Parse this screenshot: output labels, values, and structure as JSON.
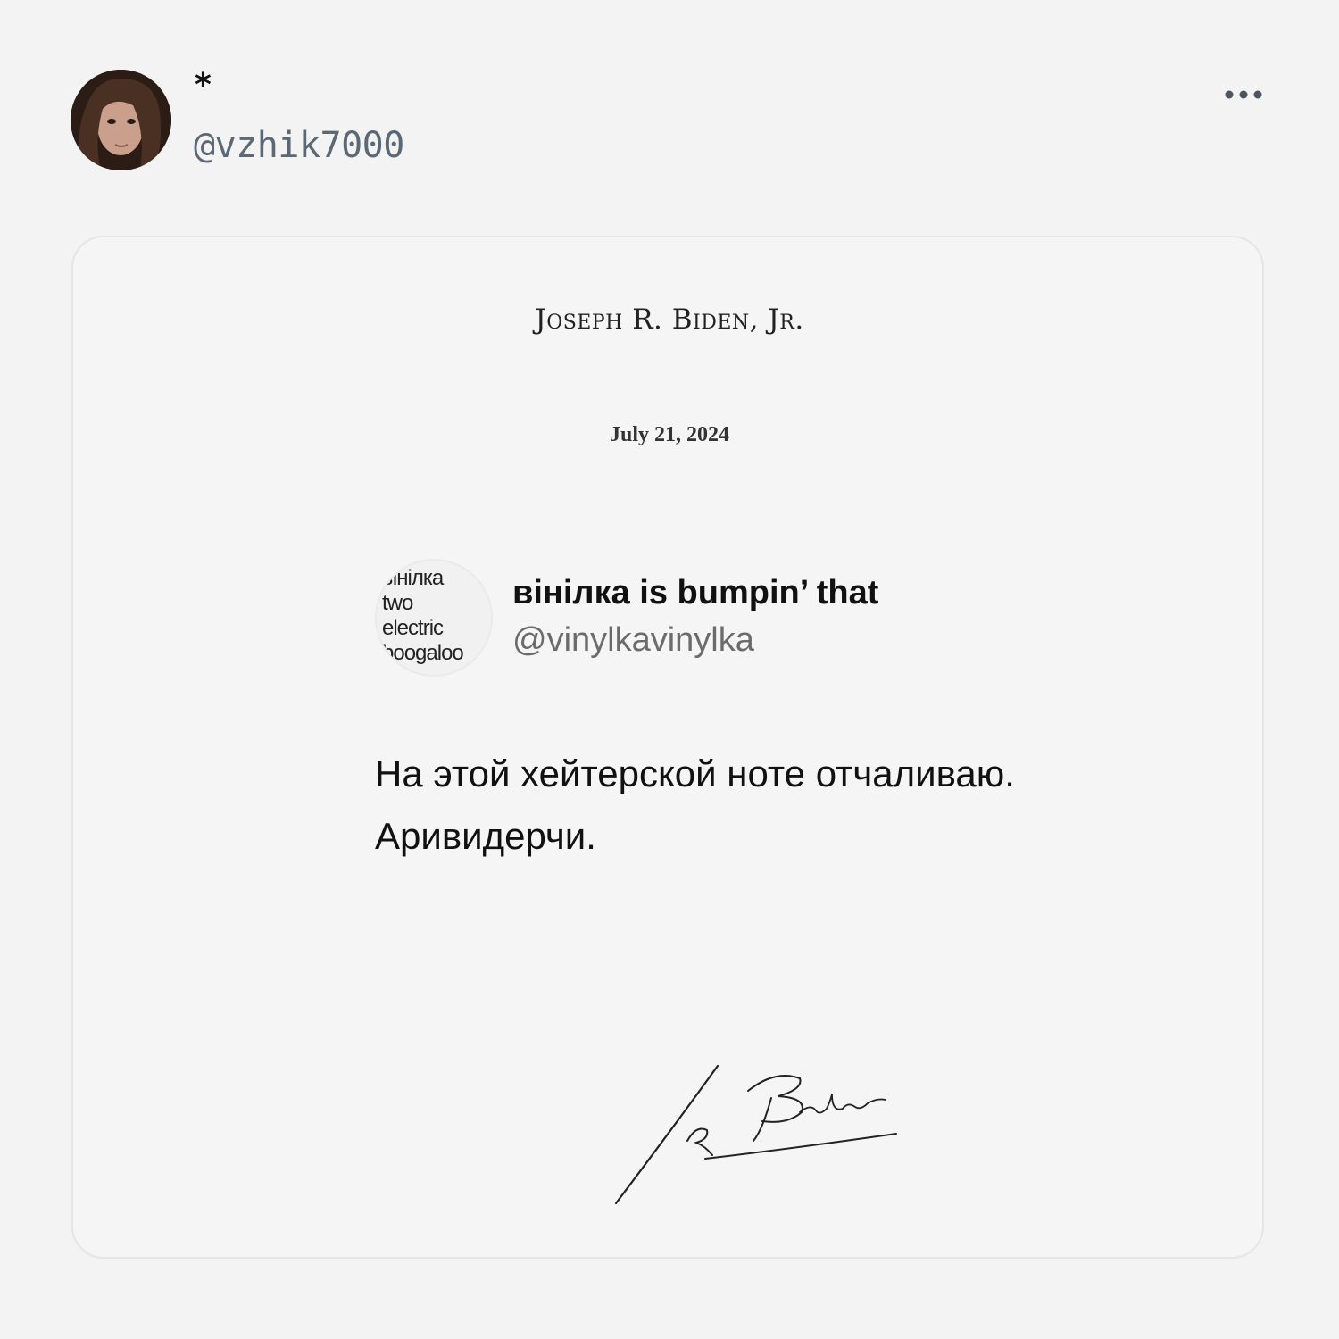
{
  "post": {
    "display_name": "*",
    "handle": "@vzhik7000",
    "more_icon": "more-horizontal-icon"
  },
  "letter": {
    "letterhead": "Joseph R. Biden, Jr.",
    "date": "July 21, 2024",
    "quoted_tweet": {
      "avatar_text": [
        "ынілка",
        "two",
        "electric",
        "boogaloo"
      ],
      "display_name": "вінілка is bumpin’ that",
      "handle": "@vinylkavinylka",
      "text_line1": "На этой хейтерской ноте отчаливаю.",
      "text_line2": "Аривидерчи."
    },
    "signature": "handwritten-signature"
  },
  "colors": {
    "background": "#f3f3f3",
    "card_background": "#f5f5f5",
    "handle_gray": "#5b6875"
  }
}
